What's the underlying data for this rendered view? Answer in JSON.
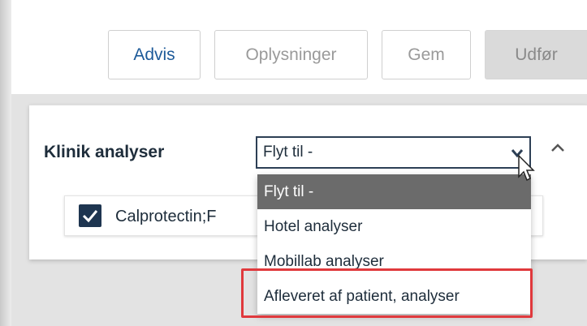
{
  "toolbar": {
    "advis_label": "Advis",
    "oplysninger_label": "Oplysninger",
    "gem_label": "Gem",
    "udfor_label": "Udfør"
  },
  "section": {
    "title": "Klinik analyser",
    "select": {
      "value": "Flyt til -",
      "options": [
        {
          "label": "Flyt til -",
          "selected": true
        },
        {
          "label": "Hotel analyser",
          "selected": false
        },
        {
          "label": "Mobillab analyser",
          "selected": false
        },
        {
          "label": "Afleveret af patient, analyser",
          "selected": false
        }
      ]
    },
    "items": [
      {
        "label": "Calprotectin;F",
        "checked": true
      }
    ]
  },
  "colors": {
    "accent": "#1d5a99",
    "checkbox": "#1e3550",
    "selected_option": "#6b6b6b",
    "highlight": "#e0393d"
  },
  "icons": [
    "chevron-down-icon",
    "chevron-up-icon",
    "mouse-cursor-icon",
    "checkmark-icon"
  ]
}
